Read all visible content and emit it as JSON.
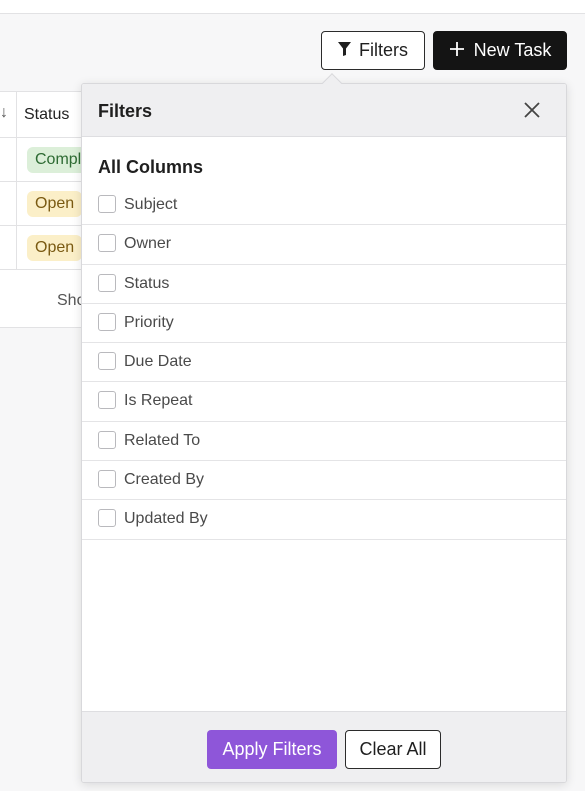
{
  "toolbar": {
    "filters_label": "Filters",
    "filters_icon": "funnel-icon",
    "new_task_label": "New Task",
    "new_task_icon": "plus-icon"
  },
  "table": {
    "status_header": "Status",
    "rows": [
      {
        "status": "Compl",
        "color": "#dcefd9"
      },
      {
        "status": "Open",
        "color": "#fbefc8"
      },
      {
        "status": "Open",
        "color": "#fbefc8"
      }
    ],
    "footer_text": "Sho"
  },
  "filter_panel": {
    "title": "Filters",
    "close_icon": "close-icon",
    "section_title": "All Columns",
    "options": [
      {
        "label": "Subject",
        "checked": false
      },
      {
        "label": "Owner",
        "checked": false
      },
      {
        "label": "Status",
        "checked": false
      },
      {
        "label": "Priority",
        "checked": false
      },
      {
        "label": "Due Date",
        "checked": false
      },
      {
        "label": "Is Repeat",
        "checked": false
      },
      {
        "label": "Related To",
        "checked": false
      },
      {
        "label": "Created By",
        "checked": false
      },
      {
        "label": "Updated By",
        "checked": false
      }
    ],
    "apply_label": "Apply Filters",
    "clear_label": "Clear All"
  },
  "colors": {
    "accent": "#8e56d9",
    "primary_dark": "#141414"
  }
}
